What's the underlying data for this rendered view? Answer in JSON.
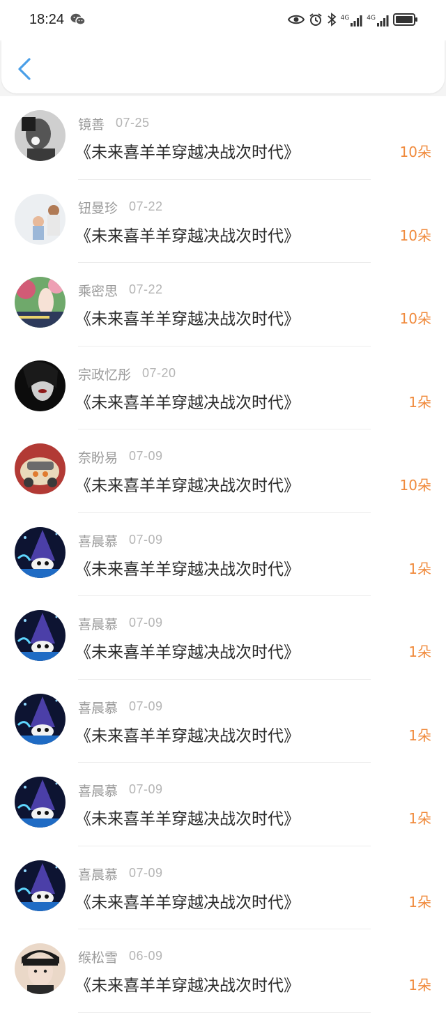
{
  "status_bar": {
    "time": "18:24",
    "network_1": "4G",
    "network_2": "4G",
    "icons": [
      "wechat-icon",
      "eye-icon",
      "alarm-icon",
      "bluetooth-icon",
      "signal-icon",
      "battery-icon"
    ]
  },
  "nav": {
    "back_icon": "chevron-left-icon"
  },
  "colors": {
    "count": "#f08a3c",
    "name": "#9a9a9a",
    "date": "#b4b4b4",
    "title": "#2b2b2b",
    "back": "#4a9fe8"
  },
  "items": [
    {
      "name": "镜善",
      "date": "07-25",
      "title": "《未来喜羊羊穿越决战次时代》",
      "count": "10朵",
      "avatar": "bw-portrait"
    },
    {
      "name": "钮曼珍",
      "date": "07-22",
      "title": "《未来喜羊羊穿越决战次时代》",
      "count": "10朵",
      "avatar": "parent-child-photo"
    },
    {
      "name": "乘密思",
      "date": "07-22",
      "title": "《未来喜羊羊穿越决战次时代》",
      "count": "10朵",
      "avatar": "girl-garden-photo"
    },
    {
      "name": "宗政忆彤",
      "date": "07-20",
      "title": "《未来喜羊羊穿越决战次时代》",
      "count": "1朵",
      "avatar": "dark-woman-photo"
    },
    {
      "name": "奈盼易",
      "date": "07-09",
      "title": "《未来喜羊羊穿越决战次时代》",
      "count": "10朵",
      "avatar": "toy-car-photo"
    },
    {
      "name": "喜晨慕",
      "date": "07-09",
      "title": "《未来喜羊羊穿越决战次时代》",
      "count": "1朵",
      "avatar": "wizard-cartoon"
    },
    {
      "name": "喜晨慕",
      "date": "07-09",
      "title": "《未来喜羊羊穿越决战次时代》",
      "count": "1朵",
      "avatar": "wizard-cartoon"
    },
    {
      "name": "喜晨慕",
      "date": "07-09",
      "title": "《未来喜羊羊穿越决战次时代》",
      "count": "1朵",
      "avatar": "wizard-cartoon"
    },
    {
      "name": "喜晨慕",
      "date": "07-09",
      "title": "《未来喜羊羊穿越决战次时代》",
      "count": "1朵",
      "avatar": "wizard-cartoon"
    },
    {
      "name": "喜晨慕",
      "date": "07-09",
      "title": "《未来喜羊羊穿越决战次时代》",
      "count": "1朵",
      "avatar": "wizard-cartoon"
    },
    {
      "name": "缑松雪",
      "date": "06-09",
      "title": "《未来喜羊羊穿越决战次时代》",
      "count": "1朵",
      "avatar": "anime-boy"
    }
  ]
}
